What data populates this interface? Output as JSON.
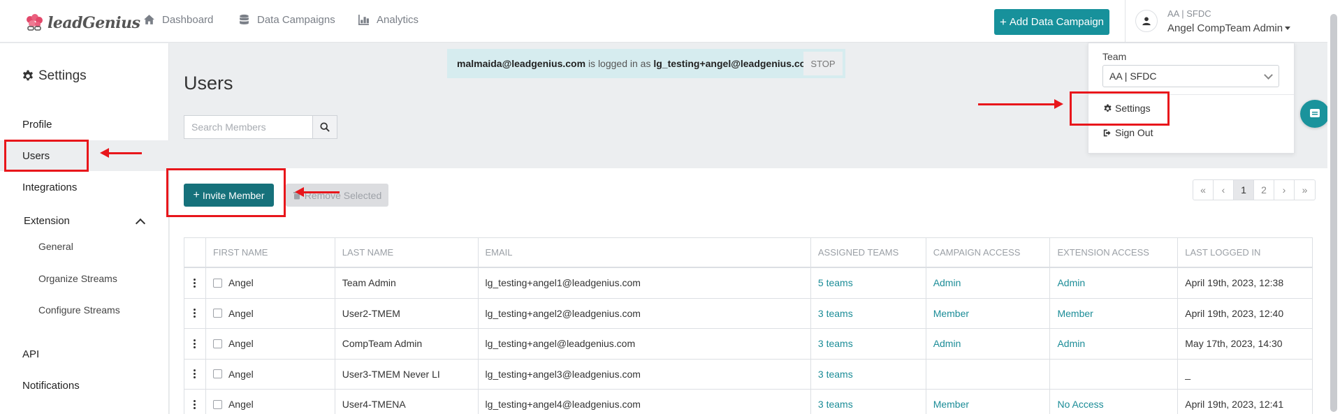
{
  "app": {
    "logo_text": "leadGenius"
  },
  "topnav": {
    "items": [
      {
        "label": "Dashboard",
        "icon": "home-icon"
      },
      {
        "label": "Data Campaigns",
        "icon": "database-icon"
      },
      {
        "label": "Analytics",
        "icon": "bar-chart-icon"
      }
    ],
    "add_campaign_label": "Add Data Campaign",
    "user": {
      "team": "AA | SFDC",
      "name": "Angel CompTeam Admin"
    }
  },
  "sidebar": {
    "title": "Settings",
    "items": [
      {
        "label": "Profile"
      },
      {
        "label": "Users"
      },
      {
        "label": "Integrations"
      },
      {
        "label": "Extension"
      },
      {
        "label": "General"
      },
      {
        "label": "Organize Streams"
      },
      {
        "label": "Configure Streams"
      },
      {
        "label": "API"
      },
      {
        "label": "Notifications"
      }
    ]
  },
  "banner": {
    "impersonator": "malmaida@leadgenius.com",
    "middle": "is logged in as",
    "target": "lg_testing+angel@leadgenius.com",
    "stop_label": "STOP"
  },
  "page": {
    "title": "Users"
  },
  "search": {
    "placeholder": "Search Members"
  },
  "actions": {
    "invite_label": "Invite Member",
    "remove_label": "Remove Selected"
  },
  "pagination": [
    "«",
    "‹",
    "1",
    "2",
    "›",
    "»"
  ],
  "table": {
    "columns": [
      "First Name",
      "Last Name",
      "Email",
      "Assigned Teams",
      "Campaign Access",
      "Extension Access",
      "Last Logged In"
    ],
    "rows": [
      {
        "first": "Angel",
        "last": "Team Admin",
        "email": "lg_testing+angel1@leadgenius.com",
        "teams": "5 teams",
        "campaign": "Admin",
        "extension": "Admin",
        "last_login": "April 19th, 2023, 12:38"
      },
      {
        "first": "Angel",
        "last": "User2-TMEM",
        "email": "lg_testing+angel2@leadgenius.com",
        "teams": "3 teams",
        "campaign": "Member",
        "extension": "Member",
        "last_login": "April 19th, 2023, 12:40"
      },
      {
        "first": "Angel",
        "last": "CompTeam Admin",
        "email": "lg_testing+angel@leadgenius.com",
        "teams": "3 teams",
        "campaign": "Admin",
        "extension": "Admin",
        "last_login": "May 17th, 2023, 14:30"
      },
      {
        "first": "Angel",
        "last": "User3-TMEM Never LI",
        "email": "lg_testing+angel3@leadgenius.com",
        "teams": "3 teams",
        "campaign": "",
        "extension": "",
        "last_login": "_"
      },
      {
        "first": "Angel",
        "last": "User4-TMENA",
        "email": "lg_testing+angel4@leadgenius.com",
        "teams": "3 teams",
        "campaign": "Member",
        "extension": "No Access",
        "last_login": "April 19th, 2023, 12:41"
      }
    ]
  },
  "dropdown": {
    "team_label": "Team",
    "team_value": "AA | SFDC",
    "settings_label": "Settings",
    "signout_label": "Sign Out"
  },
  "colors": {
    "accent": "#17919b",
    "primary_button": "#16717b",
    "annotation": "#e8161b",
    "link": "#1b8c97"
  }
}
